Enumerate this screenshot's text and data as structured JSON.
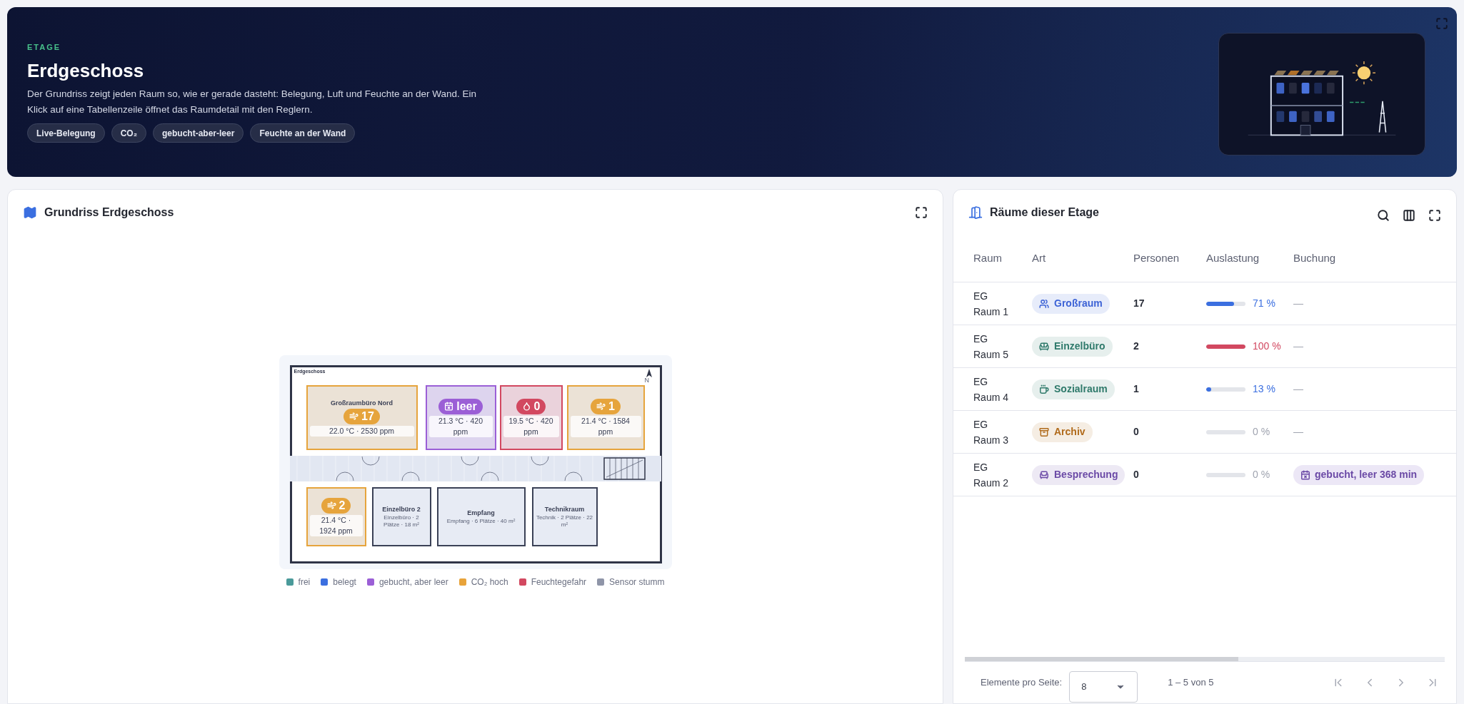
{
  "header": {
    "eyebrow": "ETAGE",
    "title": "Erdgeschoss",
    "description": "Der Grundriss zeigt jeden Raum so, wie er gerade dasteht: Belegung, Luft und Feuchte an der Wand. Ein Klick auf eine Tabellenzeile öffnet das Raumdetail mit den Reglern.",
    "tags": [
      "Live-Belegung",
      "CO₂",
      "gebucht-aber-leer",
      "Feuchte an der Wand"
    ]
  },
  "floorplan": {
    "title": "Grundriss Erdgeschoss",
    "plan_label": "Erdgeschoss",
    "north": "N",
    "rooms": [
      {
        "kind": "co2",
        "name": "Großraumbüro Nord",
        "badge": "17",
        "reading": "22.0 °C · 2530 ppm"
      },
      {
        "kind": "booked_empty",
        "badge": "leer",
        "reading": "21.3 °C · 420 ppm"
      },
      {
        "kind": "damp",
        "badge": "0",
        "reading": "19.5 °C · 420 ppm"
      },
      {
        "kind": "co2",
        "badge": "1",
        "reading": "21.4 °C · 1584 ppm"
      },
      {
        "kind": "co2",
        "badge": "2",
        "reading": "21.4 °C · 1924 ppm"
      },
      {
        "kind": "idle",
        "name": "Einzelbüro 2",
        "details": "Einzelbüro · 2 Plätze · 18 m²"
      },
      {
        "kind": "idle",
        "name": "Empfang",
        "details": "Empfang · 6 Plätze · 40 m²"
      },
      {
        "kind": "idle",
        "name": "Technikraum",
        "details": "Technik · 2 Plätze · 22 m²"
      }
    ],
    "legend": [
      {
        "label": "frei",
        "color": "#4a9a9a"
      },
      {
        "label": "belegt",
        "color": "#3b6fe0"
      },
      {
        "label": "gebucht, aber leer",
        "color": "#9b5fd6"
      },
      {
        "label": "CO₂ hoch",
        "color": "#e8a33a"
      },
      {
        "label": "Feuchtegefahr",
        "color": "#d24860"
      },
      {
        "label": "Sensor stumm",
        "color": "#8f95a8"
      }
    ]
  },
  "table": {
    "title": "Räume dieser Etage",
    "columns": [
      "Raum",
      "Art",
      "Personen",
      "Auslastung",
      "Buchung"
    ],
    "rows": [
      {
        "room": "EG Raum 1",
        "type": "Großraum",
        "kind": "group",
        "color": "#3d63d6",
        "persons": "17",
        "level": 0.71,
        "reading": "71 %",
        "booking": {
          "kind": "none",
          "text": "—"
        }
      },
      {
        "room": "EG Raum 5",
        "type": "Einzelbüro",
        "kind": "sofa",
        "color": "#2f7a6b",
        "persons": "2",
        "level": 1.0,
        "reading": "100 %",
        "booking": {
          "kind": "none",
          "text": "—"
        }
      },
      {
        "room": "EG Raum 4",
        "type": "Sozialraum",
        "kind": "mug",
        "color": "#2f7a6b",
        "persons": "1",
        "level": 0.13,
        "reading": "13 %",
        "booking": {
          "kind": "none",
          "text": "—"
        }
      },
      {
        "room": "EG Raum 3",
        "type": "Archiv",
        "kind": "archive",
        "color": "#b06a1a",
        "persons": "0",
        "level": 0,
        "reading": "0 %",
        "booking": {
          "kind": "none",
          "text": "—"
        }
      },
      {
        "room": "EG Raum 2",
        "type": "Besprechung",
        "kind": "chair",
        "color": "#6b4aa6",
        "persons": "0",
        "level": 0,
        "reading": "0 %",
        "booking": {
          "kind": "booked_empty",
          "text": "gebucht, leer 368 min"
        }
      }
    ],
    "pagination": {
      "label": "Elemente pro Seite:",
      "page_size": "8",
      "range": "1 – 5 von 5"
    }
  }
}
